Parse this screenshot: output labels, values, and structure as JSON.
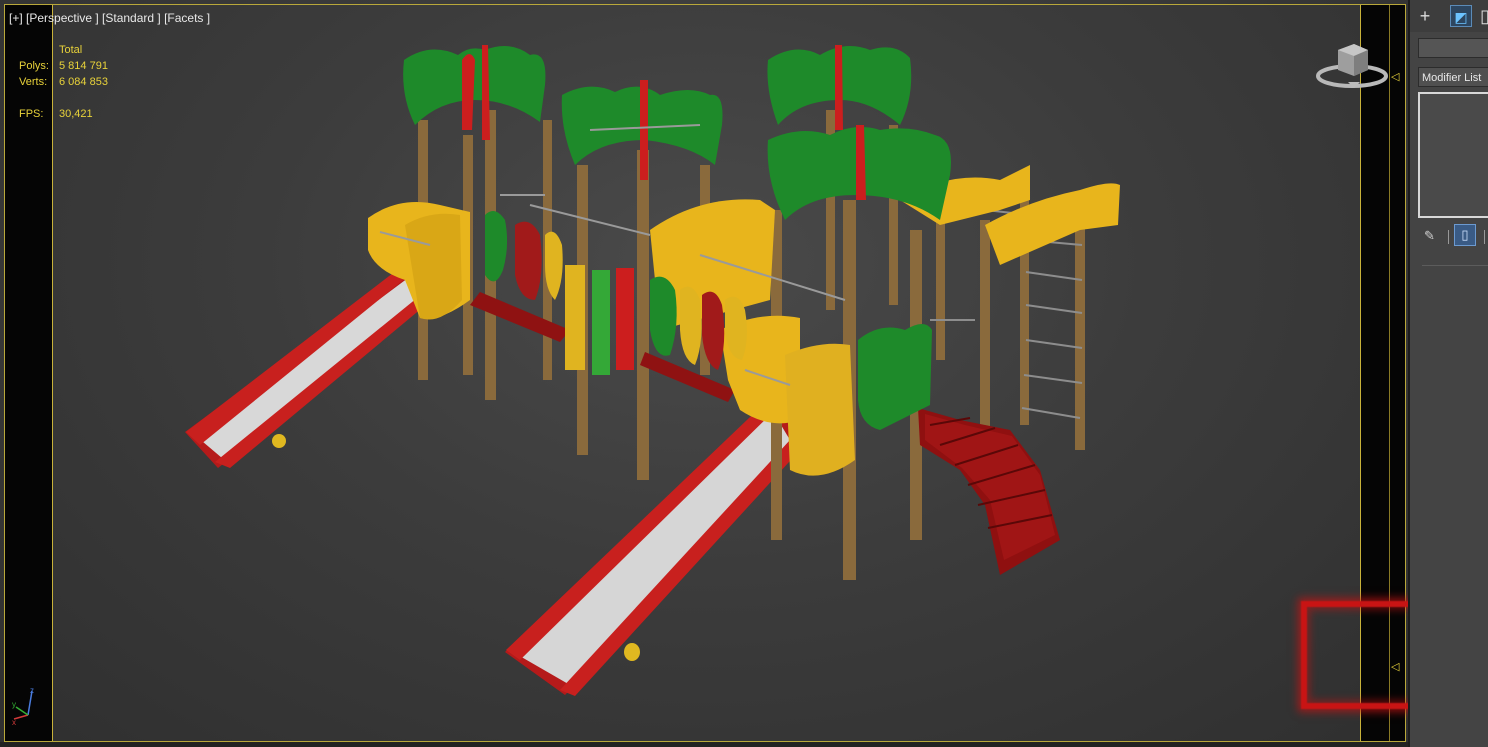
{
  "viewport": {
    "label": "[+] [Perspective ] [Standard ] [Facets ]",
    "stats": {
      "header": "Total",
      "polys_label": "Polys:",
      "polys_value": "5 814 791",
      "verts_label": "Verts:",
      "verts_value": "6 084 853",
      "fps_label": "FPS:",
      "fps_value": "30,421"
    },
    "axis_labels": {
      "x": "x",
      "y": "y",
      "z": "z"
    },
    "colors": {
      "safe_frame": "#c8b23a",
      "stats_text": "#e8d23a",
      "highlight_box": "#c81414"
    }
  },
  "command_panel": {
    "tabs": [
      {
        "icon": "plus-icon",
        "glyph": "+"
      },
      {
        "icon": "modify-icon",
        "glyph": "◩"
      },
      {
        "icon": "hierarchy-icon",
        "glyph": "▯"
      }
    ],
    "modifier_list_label": "Modifier List",
    "pin_icon": "pin-icon",
    "show_end_icon": "show-end-result-icon"
  }
}
